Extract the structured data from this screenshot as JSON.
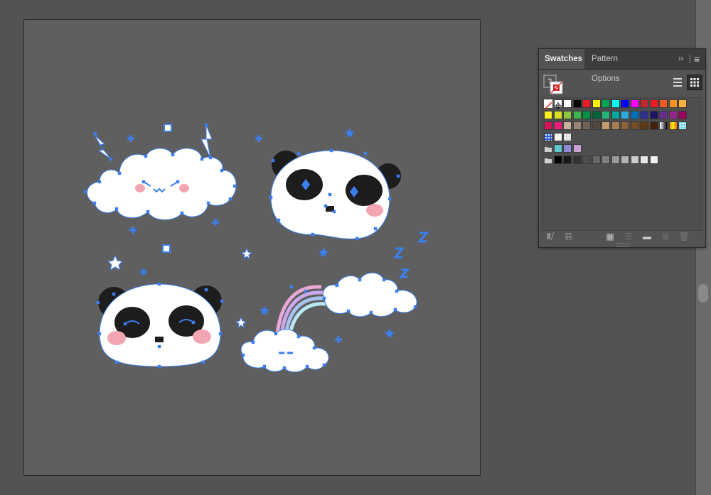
{
  "panel": {
    "tabs": [
      {
        "label": "Swatches",
        "active": true
      },
      {
        "label": "Pattern Options",
        "active": false
      }
    ],
    "expand_icon": "double-chevron-right-icon",
    "menu_icon": "hamburger-menu-icon",
    "fill_stroke_help": "?",
    "view_modes": [
      "list-view",
      "grid-view"
    ],
    "selected_view": "grid-view",
    "swatch_rows": [
      {
        "kind": "row",
        "colors": [
          "none",
          "registration",
          "#ffffff",
          "#000000",
          "#ed1c24",
          "#fff200",
          "#00a651",
          "#00ffff",
          "#0000ff",
          "#ff00ff",
          "#c1272d",
          "#ed1c24",
          "#f15a24",
          "#f7931e",
          "#fbb03b"
        ]
      },
      {
        "kind": "row",
        "colors": [
          "#fcee21",
          "#d9e021",
          "#8cc63f",
          "#39b54a",
          "#009245",
          "#006837",
          "#22b573",
          "#00a99d",
          "#29abe2",
          "#0071bc",
          "#2e3192",
          "#1b1464",
          "#662d91",
          "#93278f",
          "#9e005d"
        ]
      },
      {
        "kind": "row",
        "colors": [
          "#d4145a",
          "#ed1e79",
          "#c7b299",
          "#998675",
          "#736357",
          "#534741",
          "#c69c6d",
          "#a67c52",
          "#8c6239",
          "#754c24",
          "#603813",
          "#42210b",
          "gradient-black-white",
          "gradient-orange",
          "pattern-cyan"
        ]
      },
      {
        "kind": "pattern",
        "colors": [
          "pattern-blue-dots",
          "pattern-dots-light",
          "pattern-dots-gray"
        ]
      },
      {
        "kind": "group",
        "colors": [
          "#5dc8d0",
          "#8f8ad6",
          "#c8a2d8"
        ]
      },
      {
        "kind": "group",
        "colors": [
          "#000000",
          "#1a1a1a",
          "#333333",
          "#4d4d4d",
          "#666666",
          "#808080",
          "#999999",
          "#b3b3b3",
          "#cccccc",
          "#e6e6e6",
          "#f2f2f2"
        ]
      }
    ],
    "footer_icons": [
      "swatch-libraries-icon",
      "place-swatches-icon",
      "show-kinds-icon",
      "swatch-options-icon",
      "new-color-group-icon",
      "new-swatch-icon",
      "delete-swatch-icon"
    ]
  },
  "canvas": {
    "background": "#535353",
    "artboard_color": "#5f5f5f",
    "selection_color": "#3a7ff0",
    "objects": [
      "angry-cloud",
      "sleepy-panda-top",
      "smiling-panda",
      "rainbow-clouds",
      "lightning-bolt",
      "lightning-bolt",
      "stars",
      "z-letters"
    ]
  }
}
